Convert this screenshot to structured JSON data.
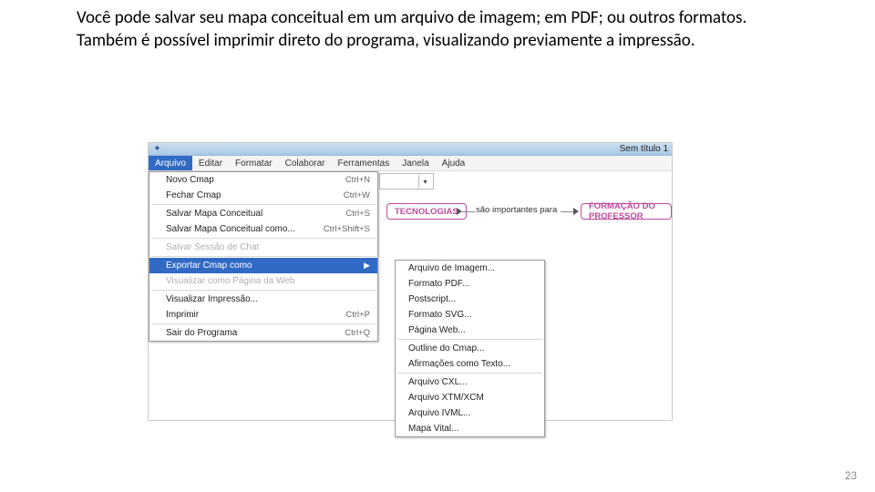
{
  "body": {
    "p1": "Você pode salvar seu mapa conceitual em um arquivo de imagem; em PDF; ou outros formatos.",
    "p2": "Também é possível imprimir direto do programa, visualizando previamente a impressão."
  },
  "page_number": "23",
  "app": {
    "window_title": "Sem título 1",
    "menubar": [
      "Arquivo",
      "Editar",
      "Formatar",
      "Colaborar",
      "Ferramentas",
      "Janela",
      "Ajuda"
    ],
    "file_menu": [
      {
        "label": "Novo Cmap",
        "shortcut": "Ctrl+N",
        "type": "item"
      },
      {
        "label": "Fechar Cmap",
        "shortcut": "Ctrl+W",
        "type": "item"
      },
      {
        "type": "sep"
      },
      {
        "label": "Salvar Mapa Conceitual",
        "shortcut": "Ctrl+S",
        "type": "item"
      },
      {
        "label": "Salvar Mapa Conceitual como...",
        "shortcut": "Ctrl+Shift+S",
        "type": "item"
      },
      {
        "type": "sep"
      },
      {
        "label": "Salvar Sessão de Chat",
        "type": "disabled"
      },
      {
        "type": "sep"
      },
      {
        "label": "Exportar Cmap como",
        "type": "highlight",
        "arrow": true
      },
      {
        "label": "Visualizar como Página da Web",
        "type": "disabled"
      },
      {
        "type": "sep"
      },
      {
        "label": "Visualizar Impressão...",
        "type": "item"
      },
      {
        "label": "Imprimir",
        "shortcut": "Ctrl+P",
        "type": "item"
      },
      {
        "type": "sep"
      },
      {
        "label": "Sair do Programa",
        "shortcut": "Ctrl+Q",
        "type": "item"
      }
    ],
    "export_submenu": [
      {
        "label": "Arquivo de Imagem...",
        "type": "item"
      },
      {
        "label": "Formato PDF...",
        "type": "item"
      },
      {
        "label": "Postscript...",
        "type": "item"
      },
      {
        "label": "Formato SVG...",
        "type": "item"
      },
      {
        "label": "Página Web...",
        "type": "item"
      },
      {
        "type": "sep"
      },
      {
        "label": "Outline do Cmap...",
        "type": "item"
      },
      {
        "label": "Afirmações como Texto...",
        "type": "item"
      },
      {
        "type": "sep"
      },
      {
        "label": "Arquivo CXL...",
        "type": "item"
      },
      {
        "label": "Arquivo XTM/XCM",
        "type": "item"
      },
      {
        "label": "Arquivo IVML...",
        "type": "item"
      },
      {
        "label": "Mapa Vital...",
        "type": "item"
      }
    ],
    "canvas": {
      "node1": "TECNOLOGIAS",
      "link": "são importantes para",
      "node2": "FORMAÇÃO DO PROFESSOR"
    }
  }
}
